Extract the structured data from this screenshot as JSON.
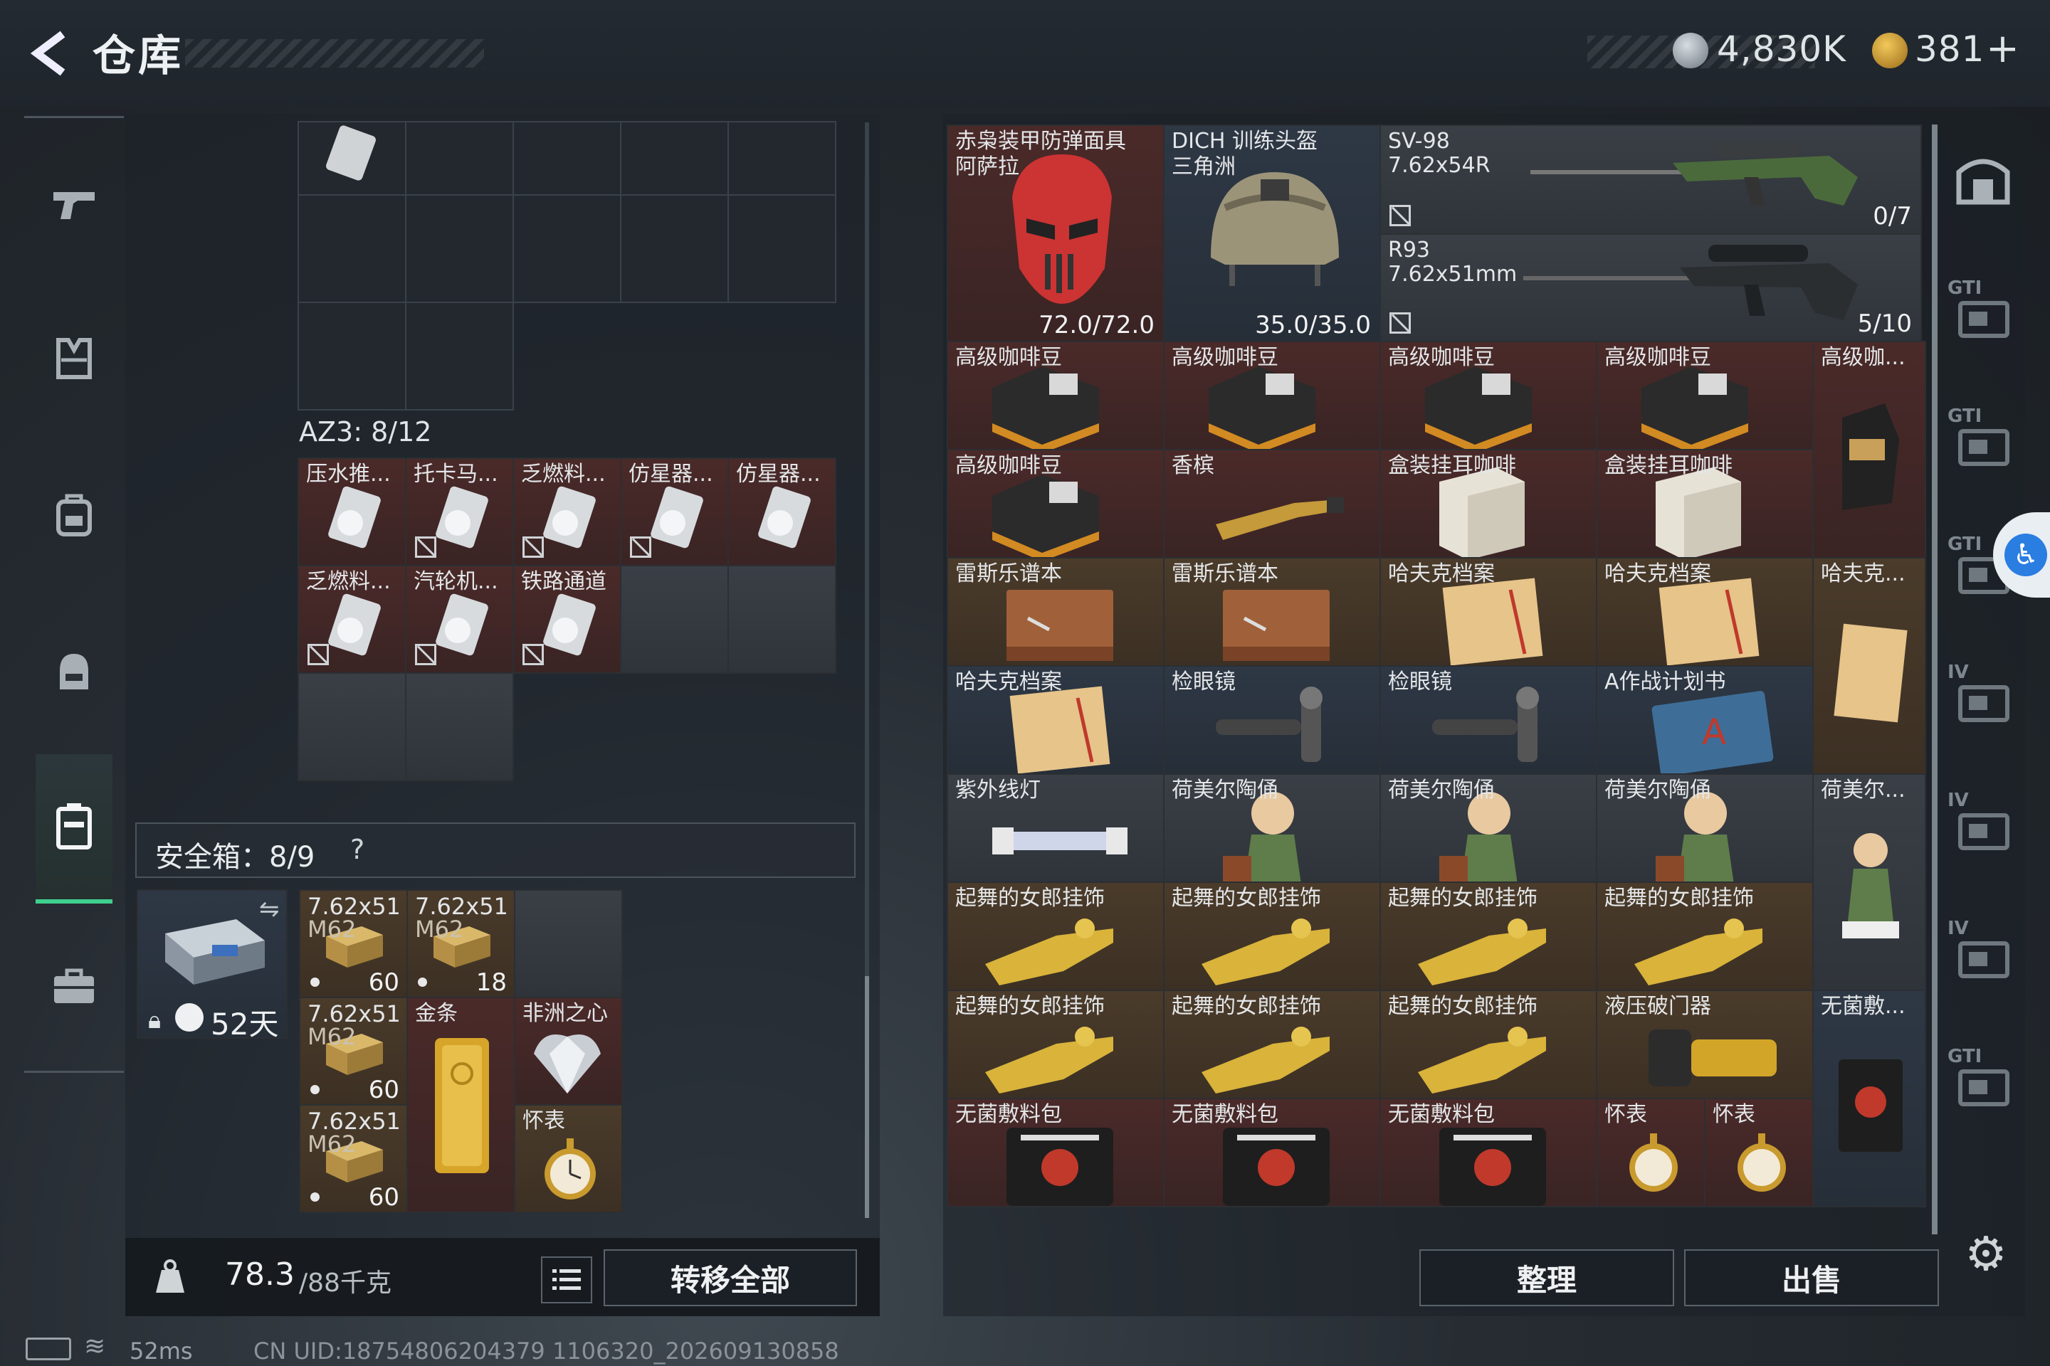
{
  "header": {
    "title": "仓库",
    "currency_silver": "4,830K",
    "currency_gold": "381",
    "currency_plus": "+"
  },
  "left_nav": {
    "items": [
      {
        "name": "pistol-icon"
      },
      {
        "name": "armor-vest-icon"
      },
      {
        "name": "backpack-icon"
      },
      {
        "name": "helmet-bag-icon"
      },
      {
        "name": "case-icon"
      },
      {
        "name": "briefcase-icon"
      }
    ]
  },
  "container": {
    "label": "AZ3: 8/12",
    "items": [
      {
        "name": "压水推...",
        "locked": false
      },
      {
        "name": "托卡马...",
        "locked": true
      },
      {
        "name": "乏燃料...",
        "locked": true
      },
      {
        "name": "仿星器...",
        "locked": true
      },
      {
        "name": "仿星器...",
        "locked": false
      },
      {
        "name": "乏燃料...",
        "locked": true
      },
      {
        "name": "汽轮机...",
        "locked": true
      },
      {
        "name": "铁路通道",
        "locked": true
      }
    ]
  },
  "safebox": {
    "label": "安全箱：8/9",
    "help": "?",
    "timer": "52天",
    "ammo": [
      {
        "name": "7.62x51",
        "sub": "M62",
        "count": "60"
      },
      {
        "name": "7.62x51",
        "sub": "M62",
        "count": "18"
      },
      {
        "name": "7.62x51",
        "sub": "M62",
        "count": "60"
      },
      {
        "name": "7.62x51",
        "sub": "M62",
        "count": "60"
      }
    ],
    "gold_bar": "金条",
    "heart": "非洲之心",
    "watch": "怀表"
  },
  "footer_left": {
    "weight_current": "78.3",
    "weight_max": "/88千克",
    "transfer_all": "转移全部"
  },
  "stash": {
    "mask": {
      "name": "赤枭装甲防弹面具",
      "name2": "阿萨拉",
      "durability": "72.0/72.0"
    },
    "helmet": {
      "name": "DICH 训练头盔",
      "name2": "三角洲",
      "durability": "35.0/35.0"
    },
    "rifle1": {
      "name": "SV-98",
      "ammo": "7.62x54R",
      "count": "0/7"
    },
    "rifle2": {
      "name": "R93",
      "ammo": "7.62x51mm",
      "count": "5/10"
    },
    "grid": [
      [
        "高级咖啡豆",
        "高级咖啡豆",
        "高级咖啡豆",
        "高级咖啡豆"
      ],
      [
        "高级咖啡豆",
        "香槟",
        "盒装挂耳咖啡",
        "盒装挂耳咖啡"
      ],
      [
        "雷斯乐谱本",
        "雷斯乐谱本",
        "哈夫克档案",
        "哈夫克档案"
      ],
      [
        "哈夫克档案",
        "检眼镜",
        "检眼镜",
        "A作战计划书"
      ],
      [
        "紫外线灯",
        "荷美尔陶俑",
        "荷美尔陶俑",
        "荷美尔陶俑"
      ],
      [
        "起舞的女郎挂饰",
        "起舞的女郎挂饰",
        "起舞的女郎挂饰",
        "起舞的女郎挂饰"
      ],
      [
        "起舞的女郎挂饰",
        "起舞的女郎挂饰",
        "起舞的女郎挂饰",
        "液压破门器"
      ],
      [
        "无菌敷料包",
        "无菌敷料包",
        "无菌敷料包"
      ]
    ],
    "watch_small": "怀表",
    "tall_col": [
      "高级咖...",
      "哈夫克...",
      "荷美尔...",
      "无菌敷..."
    ]
  },
  "right_tabs": [
    "GTI",
    "GTI",
    "GTI",
    "IV",
    "IV",
    "IV",
    "GTI"
  ],
  "footer_right": {
    "sort": "整理",
    "sell": "出售"
  },
  "status_bar": {
    "ping": "52ms",
    "uid": "CN UID:18754806204379 1106320_202609130858"
  }
}
